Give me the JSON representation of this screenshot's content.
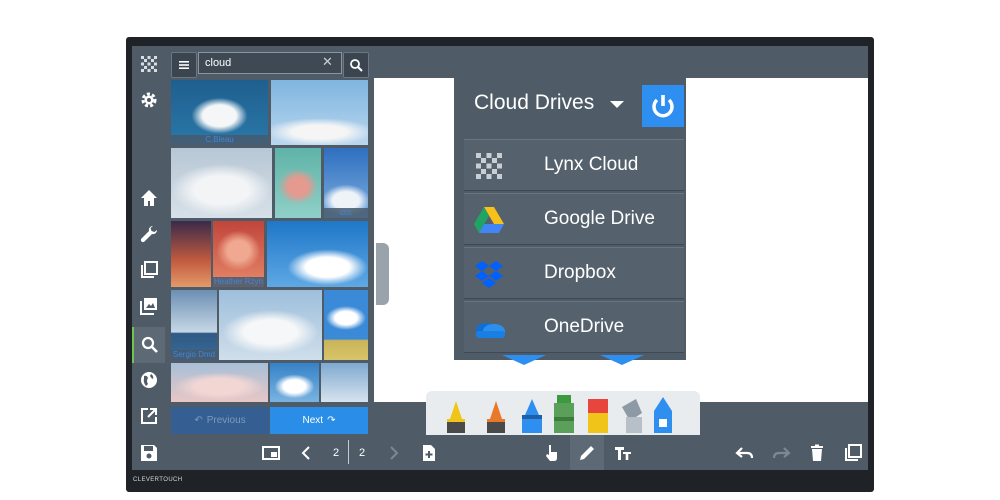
{
  "search": {
    "value": "cloud",
    "clear_icon": "close-icon",
    "button_icon": "search-icon"
  },
  "thumbnails": [
    {
      "caption": "C.Bleau"
    },
    {
      "caption": ""
    },
    {
      "caption": ""
    },
    {
      "caption": ""
    },
    {
      "caption": "ccc"
    },
    {
      "caption": ""
    },
    {
      "caption": "Heather Rzyn"
    },
    {
      "caption": ""
    },
    {
      "caption": ""
    },
    {
      "caption": "Sergio Dmd"
    },
    {
      "caption": ""
    },
    {
      "caption": ""
    }
  ],
  "pager": {
    "previous": "Previous",
    "next": "Next"
  },
  "cloud_drives": {
    "title": "Cloud Drives",
    "items": [
      {
        "label": "Lynx Cloud",
        "icon": "lynx-logo-icon"
      },
      {
        "label": "Google Drive",
        "icon": "google-drive-icon"
      },
      {
        "label": "Dropbox",
        "icon": "dropbox-icon"
      },
      {
        "label": "OneDrive",
        "icon": "onedrive-icon"
      }
    ]
  },
  "bottom": {
    "page_current": "2",
    "page_total": "2"
  },
  "brand": "CLEVERTOUCH",
  "colors": {
    "accent_blue": "#2e8ff0",
    "active_green": "#6fc64d",
    "ui_gray": "#4f5b66"
  }
}
